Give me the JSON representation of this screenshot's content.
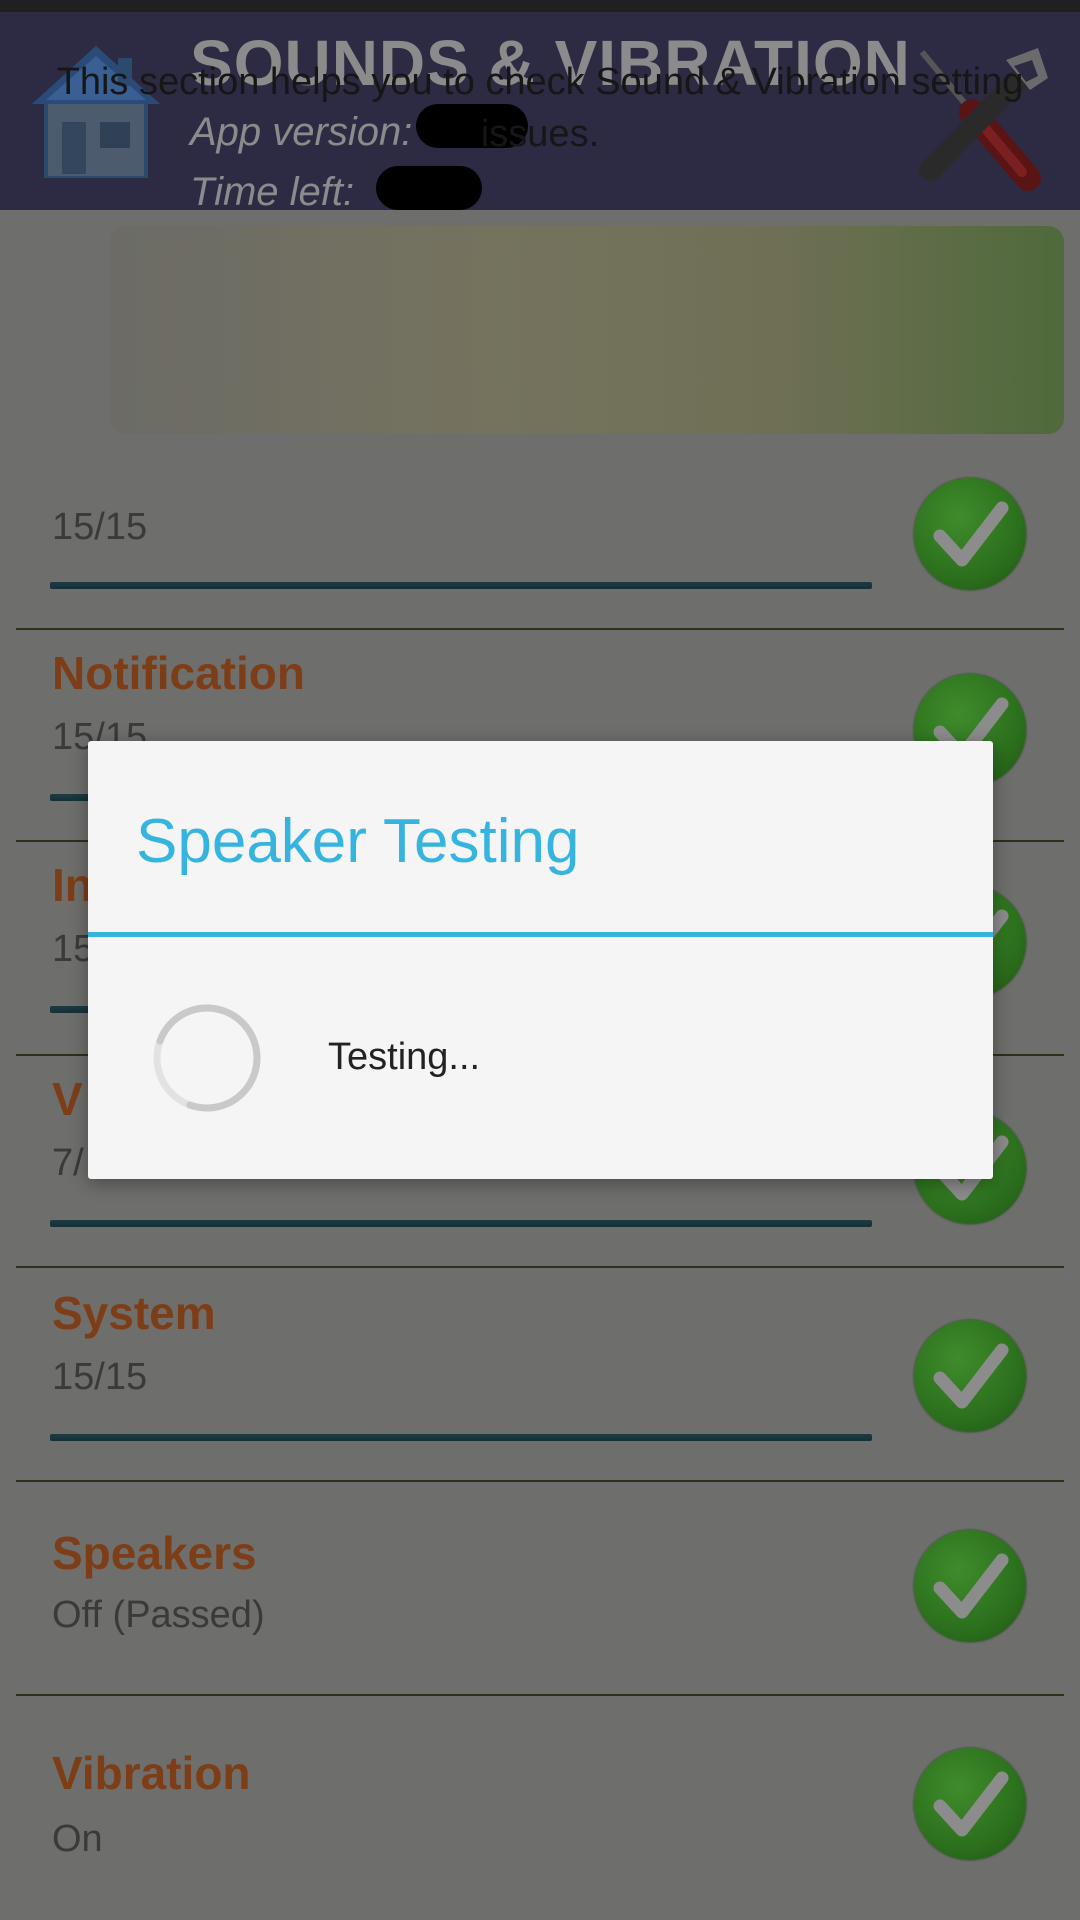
{
  "header": {
    "title": "SOUNDS & VIBRATION",
    "app_version_label": "App version:",
    "time_left_label": "Time left:"
  },
  "banner": {
    "text": "This section helps you to check Sound & Vibration setting issues."
  },
  "rows": [
    {
      "title": "",
      "value": "15/15",
      "level": 1.0
    },
    {
      "title": "Notification",
      "value": "15/15",
      "level": 1.0
    },
    {
      "title": "In",
      "value": "15",
      "level": 1.0
    },
    {
      "title": "V",
      "value": "7/",
      "level": 1.0
    },
    {
      "title": "System",
      "value": "15/15",
      "level": 1.0
    },
    {
      "title": "Speakers",
      "value": "Off (Passed)"
    },
    {
      "title": "Vibration",
      "value": "On"
    }
  ],
  "dialog": {
    "title": "Speaker Testing",
    "message": "Testing..."
  },
  "colors": {
    "header_bg": "#2d2b44",
    "accent": "#35b4e0",
    "row_title": "#7d3e17",
    "check_green": "#2c701d"
  },
  "icons": {
    "home": "home-icon",
    "tools": "tools-icon",
    "check": "check-icon",
    "spinner": "spinner-icon"
  }
}
